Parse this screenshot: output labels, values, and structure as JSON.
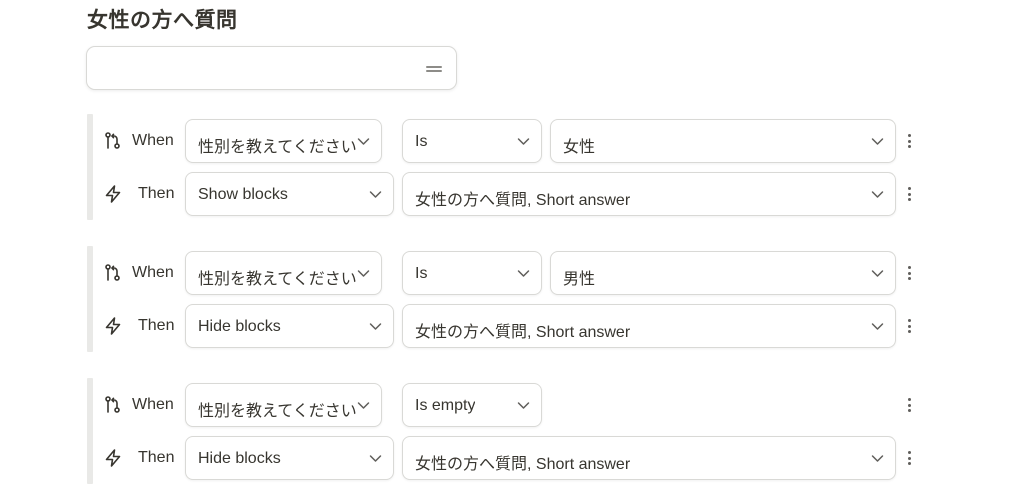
{
  "page_title": "女性の方へ質問",
  "question_input": {
    "value": ""
  },
  "rules": [
    {
      "when": {
        "label": "When",
        "field": "性別を教えてください",
        "operator": "Is",
        "value": "女性"
      },
      "then": {
        "label": "Then",
        "action": "Show blocks",
        "target": "女性の方へ質問, Short answer"
      }
    },
    {
      "when": {
        "label": "When",
        "field": "性別を教えてください",
        "operator": "Is",
        "value": "男性"
      },
      "then": {
        "label": "Then",
        "action": "Hide blocks",
        "target": "女性の方へ質問, Short answer"
      }
    },
    {
      "when": {
        "label": "When",
        "field": "性別を教えてください",
        "operator": "Is empty",
        "value": null
      },
      "then": {
        "label": "Then",
        "action": "Hide blocks",
        "target": "女性の方へ質問, Short answer"
      }
    }
  ],
  "icons": {
    "when": "branch-condition-icon",
    "then": "lightning-bolt-icon",
    "dropdown": "chevron-down-icon",
    "more": "more-vertical-icon",
    "handle": "drag-handle-icon"
  }
}
